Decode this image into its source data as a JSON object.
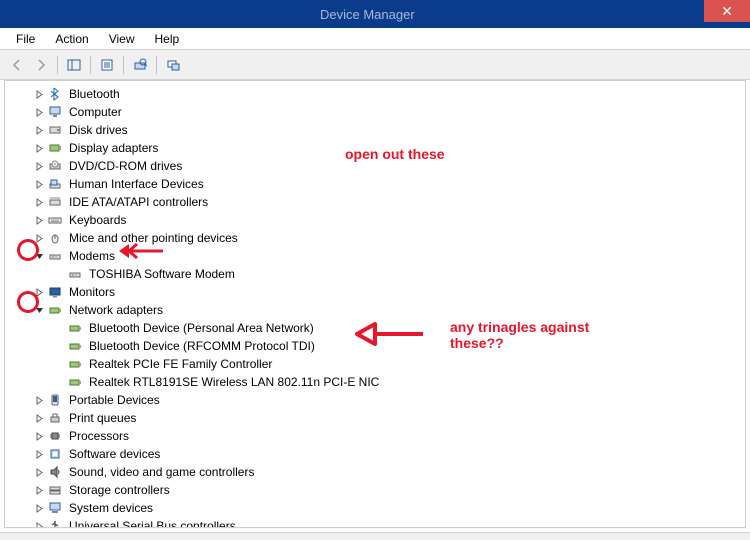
{
  "window": {
    "title": "Device Manager",
    "close_label": "✕"
  },
  "menu": {
    "file": "File",
    "action": "Action",
    "view": "View",
    "help": "Help"
  },
  "tree": {
    "bluetooth": "Bluetooth",
    "computer": "Computer",
    "disk_drives": "Disk drives",
    "display_adapters": "Display adapters",
    "dvd": "DVD/CD-ROM drives",
    "hid": "Human Interface Devices",
    "ide": "IDE ATA/ATAPI controllers",
    "keyboards": "Keyboards",
    "mice": "Mice and other pointing devices",
    "modems": "Modems",
    "modem_toshiba": "TOSHIBA Software Modem",
    "monitors": "Monitors",
    "network": "Network adapters",
    "net_bt_pan": "Bluetooth Device (Personal Area Network)",
    "net_bt_rfcomm": "Bluetooth Device (RFCOMM Protocol TDI)",
    "net_realtek_fe": "Realtek PCIe FE Family Controller",
    "net_realtek_wifi": "Realtek RTL8191SE Wireless LAN 802.11n PCI-E NIC",
    "portable": "Portable Devices",
    "print_queues": "Print queues",
    "processors": "Processors",
    "software_devices": "Software devices",
    "sound": "Sound, video and game controllers",
    "storage": "Storage controllers",
    "system": "System devices",
    "usb": "Universal Serial Bus controllers"
  },
  "annotations": {
    "open_out": "open out these",
    "any_triangles": "any trinagles against these??"
  },
  "colors": {
    "annotation": "#e8152b",
    "titlebar": "#0b3c8c"
  }
}
